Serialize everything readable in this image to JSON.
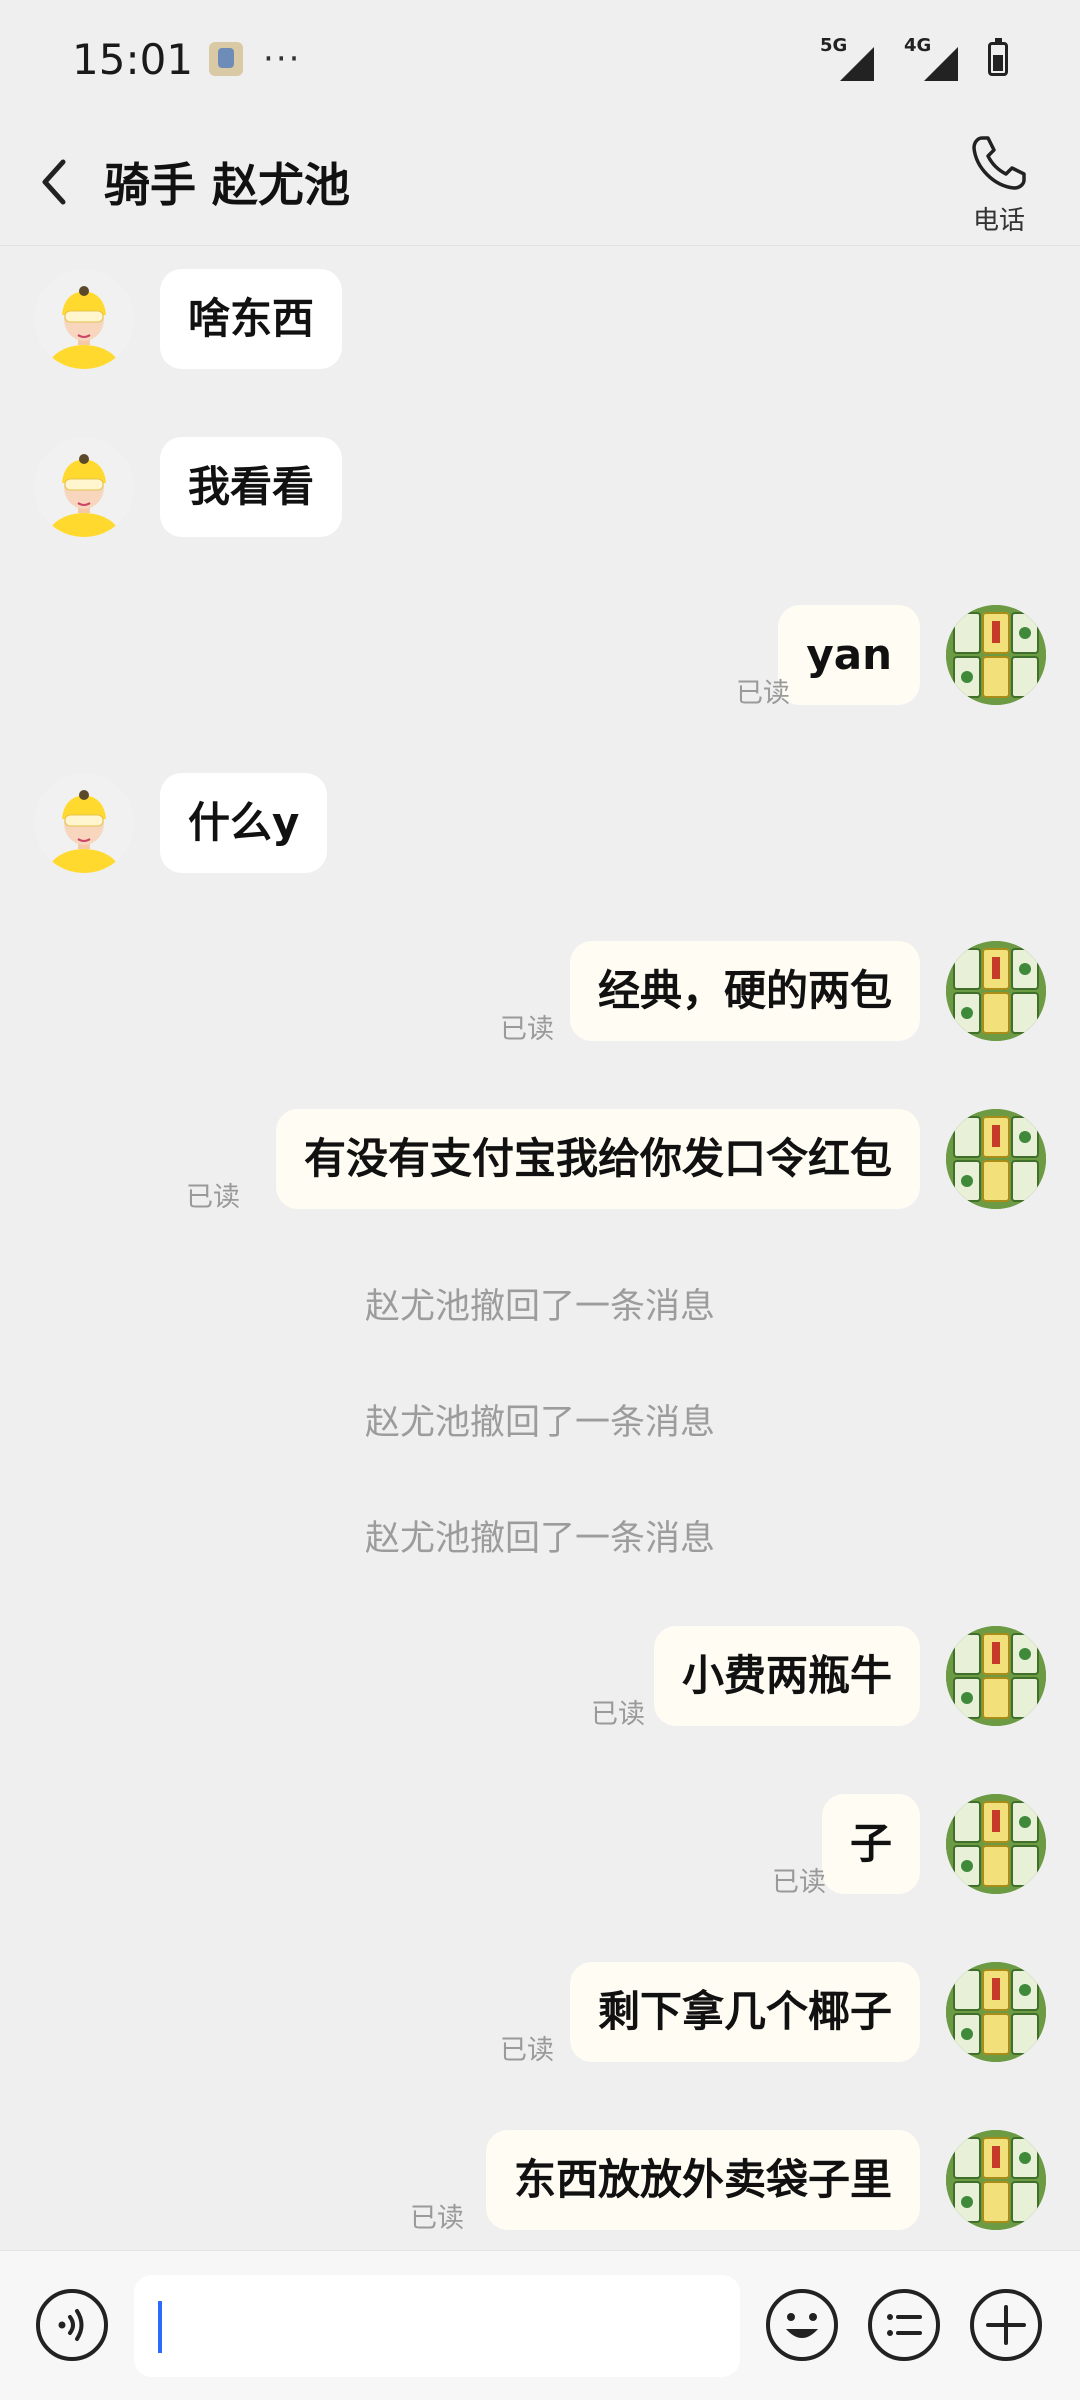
{
  "status_bar": {
    "time": "15:01",
    "dots": "···",
    "signal1": "5G",
    "signal2": "4G"
  },
  "header": {
    "title": "骑手 赵尤池",
    "call_label": "电话"
  },
  "messages": [
    {
      "side": "in",
      "text": "啥东西"
    },
    {
      "side": "in",
      "text": "我看看"
    },
    {
      "side": "out",
      "text": "yan",
      "status": "已读"
    },
    {
      "side": "in",
      "text": "什么y"
    },
    {
      "side": "out",
      "text": "经典，硬的两包",
      "status": "已读"
    },
    {
      "side": "out",
      "text": "有没有支付宝我给你发口令红包",
      "status": "已读"
    },
    {
      "side": "system",
      "text": "赵尤池撤回了一条消息"
    },
    {
      "side": "system",
      "text": "赵尤池撤回了一条消息"
    },
    {
      "side": "system",
      "text": "赵尤池撤回了一条消息"
    },
    {
      "side": "out",
      "text": "小费两瓶牛",
      "status": "已读"
    },
    {
      "side": "out",
      "text": "子",
      "status": "已读"
    },
    {
      "side": "out",
      "text": "剩下拿几个椰子",
      "status": "已读"
    },
    {
      "side": "out",
      "text": "东西放放外卖袋子里",
      "status": "已读"
    }
  ],
  "input": {
    "value": "",
    "placeholder": ""
  },
  "icons": {
    "voice": "voice-icon",
    "emoji": "emoji-icon",
    "quick_reply": "list-icon",
    "more": "plus-icon"
  },
  "colors": {
    "background": "#efefef",
    "incoming_bubble": "#ffffff",
    "outgoing_bubble": "#fffdf3",
    "read_text": "#9a9a9a",
    "caret": "#2b6cff"
  }
}
